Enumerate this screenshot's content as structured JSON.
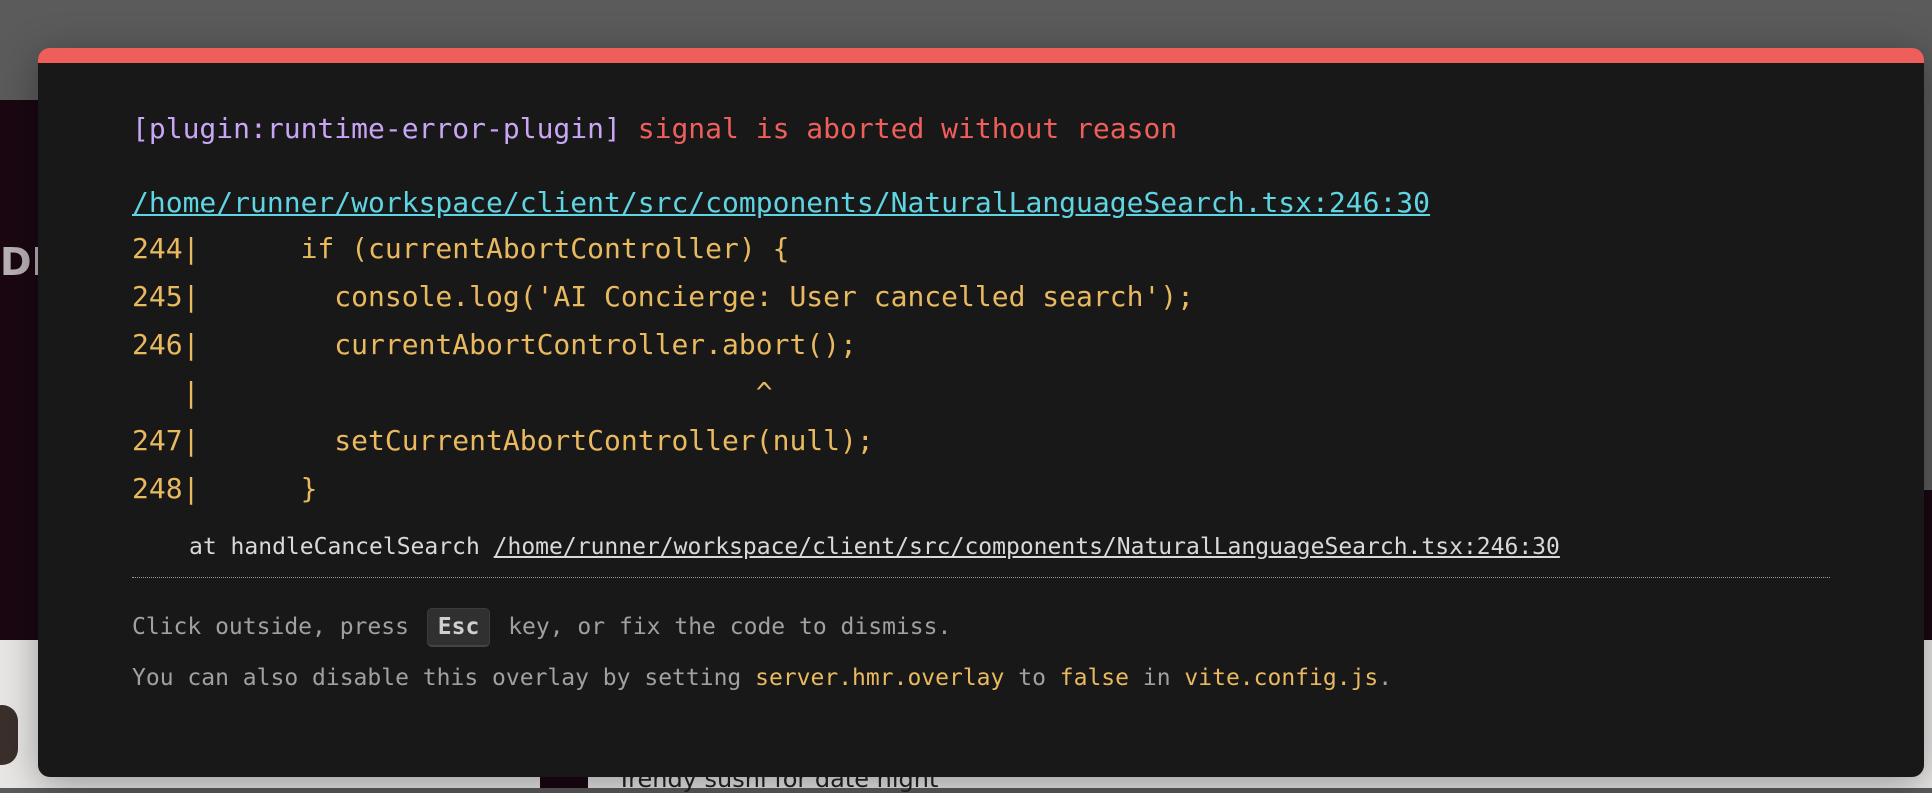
{
  "overlay": {
    "plugin": "[plugin:runtime-error-plugin]",
    "message": "signal is aborted without reason",
    "file_link": "/home/runner/workspace/client/src/components/NaturalLanguageSearch.tsx:246:30",
    "code_lines": [
      "244|      if (currentAbortController) {",
      "245|        console.log('AI Concierge: User cancelled search');",
      "246|        currentAbortController.abort();",
      "   |                                 ^",
      "247|        setCurrentAbortController(null);",
      "248|      }"
    ],
    "stack_prefix": "at handleCancelSearch ",
    "stack_path": "/home/runner/workspace/client/src/components/NaturalLanguageSearch.tsx:246:30",
    "tip1_before": "Click outside, press ",
    "tip1_key": "Esc",
    "tip1_after": " key, or fix the code to dismiss.",
    "tip2_a": "You can also disable this overlay by setting ",
    "tip2_setting": "server.hmr.overlay",
    "tip2_b": " to ",
    "tip2_value": "false",
    "tip2_c": " in ",
    "tip2_file": "vite.config.js",
    "tip2_end": "."
  },
  "background": {
    "sidebar_text": "DIN",
    "caption": "Trendy sushi for date night"
  },
  "colors": {
    "accent_bar": "#ee5f5b",
    "plugin": "#c9a6f5",
    "message": "#ee5f5b",
    "link": "#5fd5e3",
    "code": "#e9b95f",
    "overlay_bg": "#181818"
  }
}
